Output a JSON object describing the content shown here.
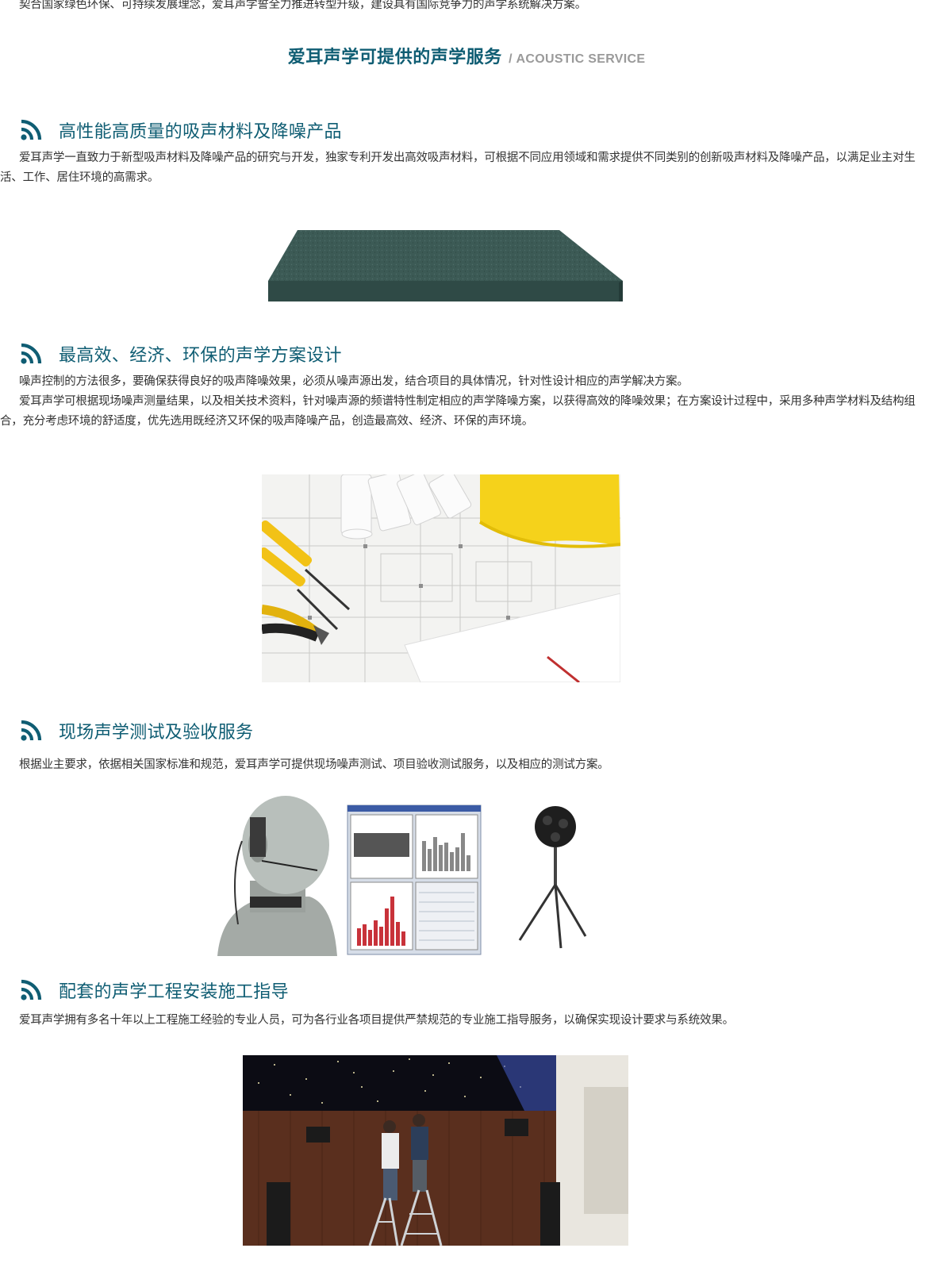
{
  "intro": "契合国家绿色环保、可持续发展理念，爱耳声学誓全力推进转型升级，建设具有国际竞争力的声学系统解决方案。",
  "heading": {
    "main": "爱耳声学可提供的声学服务",
    "sub": "/ ACOUSTIC SERVICE",
    "color": "#0f5d73"
  },
  "icons": {
    "section_icon": "rss-icon",
    "icon_color": "#0f5d73"
  },
  "sections": [
    {
      "title": "高性能高质量的吸声材料及降噪产品",
      "paragraphs": [
        "爱耳声学一直致力于新型吸声材料及降噪产品的研究与开发，独家专利开发出高效吸声材料，可根据不同应用领域和需求提供不同类别的创新吸声材料及降噪产品，以满足业主对生活、工作、居住环境的高需求。"
      ]
    },
    {
      "title": "最高效、经济、环保的声学方案设计",
      "paragraphs": [
        "噪声控制的方法很多，要确保获得良好的吸声降噪效果，必须从噪声源出发，结合项目的具体情况，针对性设计相应的声学解决方案。",
        "爱耳声学可根据现场噪声测量结果，以及相关技术资料，针对噪声源的频谱特性制定相应的声学降噪方案，以获得高效的降噪效果；在方案设计过程中，采用多种声学材料及结构组合，充分考虑环境的舒适度，优先选用既经济又环保的吸声降噪产品，创造最高效、经济、环保的声环境。"
      ]
    },
    {
      "title": "现场声学测试及验收服务",
      "paragraphs": [
        "根据业主要求，依据相关国家标准和规范，爱耳声学可提供现场噪声测试、项目验收测试服务，以及相应的测试方案。"
      ]
    },
    {
      "title": "配套的声学工程安装施工指导",
      "paragraphs": [
        "爱耳声学拥有多名十年以上工程施工经验的专业人员，可为各行业各项目提供严禁规范的专业施工指导服务，以确保实现设计要求与系统效果。"
      ]
    }
  ]
}
